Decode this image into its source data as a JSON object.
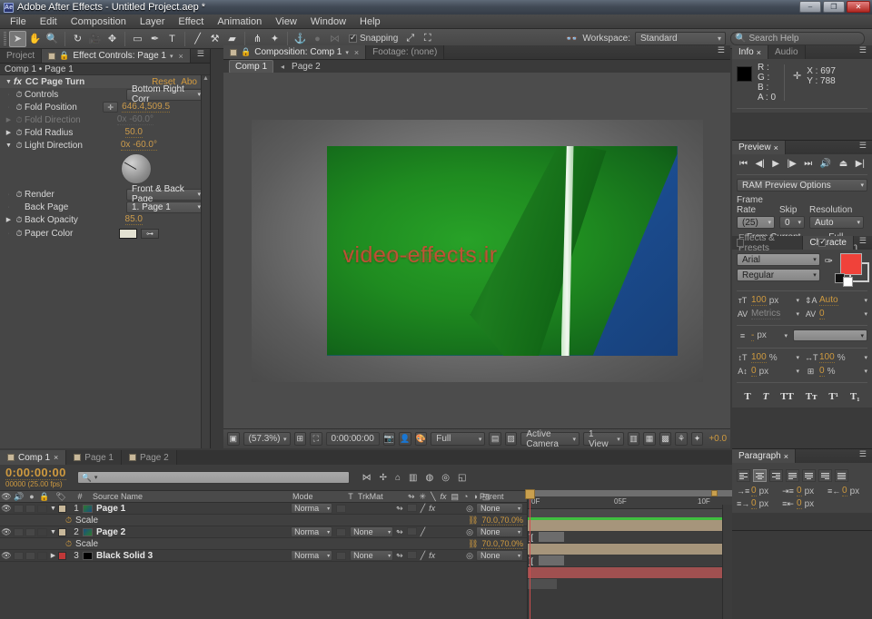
{
  "window": {
    "title": "Adobe After Effects - Untitled Project.aep *",
    "logo": "Ae",
    "minimize": "–",
    "maximize": "❐",
    "close": "✕"
  },
  "menu": [
    "File",
    "Edit",
    "Composition",
    "Layer",
    "Effect",
    "Animation",
    "View",
    "Window",
    "Help"
  ],
  "toolbar": {
    "tools": [
      {
        "name": "selection-tool",
        "glyph": "➤"
      },
      {
        "name": "hand-tool",
        "glyph": "✋"
      },
      {
        "name": "zoom-tool",
        "glyph": "🔍"
      },
      {
        "name": "rotation-tool",
        "glyph": "↻"
      },
      {
        "name": "camera-tool",
        "glyph": "🎥"
      },
      {
        "name": "pan-behind-tool",
        "glyph": "✥"
      },
      {
        "name": "rectangle-tool",
        "glyph": "▭"
      },
      {
        "name": "pen-tool",
        "glyph": "✒"
      },
      {
        "name": "text-tool",
        "glyph": "T"
      },
      {
        "name": "brush-tool",
        "glyph": "╱"
      },
      {
        "name": "clone-stamp-tool",
        "glyph": "⚒"
      },
      {
        "name": "eraser-tool",
        "glyph": "▰"
      },
      {
        "name": "roto-brush-tool",
        "glyph": "⋔"
      },
      {
        "name": "puppet-pin-tool",
        "glyph": "✦"
      }
    ],
    "anchor_icons": [
      "⚓",
      "●",
      "⋈"
    ],
    "snapping_label": "Snapping",
    "snapping_checked": true,
    "extra_icons": [
      "⤢",
      "⛶"
    ],
    "workspace_label": "Workspace:",
    "workspace_value": "Standard",
    "search_placeholder": "Search Help"
  },
  "effect_controls": {
    "project_tab": "Project",
    "tab_title": "Effect Controls: Page 1",
    "breadcrumb": "Comp 1 • Page 1",
    "effect_name": "CC Page Turn",
    "fx_label": "fx",
    "reset_label": "Reset",
    "about_label": "Abo",
    "properties": [
      {
        "name": "Controls",
        "value": "Bottom Right Corr",
        "type": "select"
      },
      {
        "name": "Fold Position",
        "value": "646.4,509.5",
        "type": "position"
      },
      {
        "name": "Fold Direction",
        "value": "0x -60.0°",
        "type": "angle",
        "disabled": true
      },
      {
        "name": "Fold Radius",
        "value": "50.0",
        "type": "number"
      },
      {
        "name": "Light Direction",
        "value": "0x -60.0°",
        "type": "angle-dial"
      },
      {
        "name": "Render",
        "value": "Front & Back Page",
        "type": "select"
      },
      {
        "name": "Back Page",
        "value": "1. Page 1",
        "type": "select"
      },
      {
        "name": "Back Opacity",
        "value": "85.0",
        "type": "number"
      },
      {
        "name": "Paper Color",
        "value": "",
        "type": "color",
        "color": "#e4e2d2"
      }
    ]
  },
  "composition": {
    "tab_title": "Composition: Comp 1",
    "footage_tab": "Footage: (none)",
    "breadcrumb_active": "Comp 1",
    "breadcrumb_next": "Page 2",
    "watermark_text": "video-effects.ir",
    "page_front_color": "#1f8b20",
    "page_back_color": "#1d539c",
    "watermark_color": "#e0453a",
    "bottom_bar": {
      "zoom": "(57.3%)",
      "time": "0:00:00:00",
      "resolution": "Full",
      "view_camera": "Active Camera",
      "view_count": "1 View",
      "exposure": "+0.0"
    }
  },
  "info_panel": {
    "tabs": [
      "Info",
      "Audio"
    ],
    "active_tab": "Info",
    "r_label": "R :",
    "g_label": "G :",
    "b_label": "B :",
    "a_label": "A : 0",
    "x_value": "X : 697",
    "y_value": "Y : 788"
  },
  "preview_panel": {
    "tab": "Preview",
    "transport": [
      "⏮",
      "◀|",
      "▶",
      "|▶",
      "⏭",
      "🔊",
      "⏏",
      "▶|"
    ],
    "ram_preview_options": "RAM Preview Options",
    "frame_rate_label": "Frame Rate",
    "frame_rate_value": "(25)",
    "skip_label": "Skip",
    "skip_value": "0",
    "resolution_label": "Resolution",
    "resolution_value": "Auto",
    "from_current_time_label": "From Current Time",
    "from_current_time_checked": false,
    "full_screen_label": "Full Screen",
    "full_screen_checked": true
  },
  "character_panel": {
    "tabs": [
      "Effects & Presets",
      "Characte"
    ],
    "active_tab": "Characte",
    "font_family": "Arial",
    "font_style": "Regular",
    "fill_color": "#f0423a",
    "font_size": "100",
    "font_size_unit": "px",
    "leading": "Auto",
    "kerning": "Metrics",
    "tracking": "0",
    "stroke_width": "-",
    "stroke_unit": "px",
    "vertical_scale": "100",
    "horizontal_scale": "100",
    "baseline_shift": "0",
    "baseline_unit": "px",
    "tsume": "0",
    "tsume_unit": "%",
    "percent": "%",
    "styles": [
      "T",
      "T",
      "TT",
      "Tᴛ",
      "T¹",
      "T₁"
    ]
  },
  "paragraph_panel": {
    "tab": "Paragraph",
    "align_buttons": [
      "left",
      "center",
      "right",
      "justify-last-left",
      "justify-last-center",
      "justify-last-right",
      "justify-all"
    ],
    "selected_align": 1,
    "indent_left": "0",
    "indent_right": "0",
    "indent_first": "0",
    "space_before": "0",
    "space_after": "0",
    "unit": "px"
  },
  "timeline": {
    "tabs": [
      {
        "label": "Comp 1",
        "active": true
      },
      {
        "label": "Page 1",
        "active": false
      },
      {
        "label": "Page 2",
        "active": false
      }
    ],
    "current_time": "0:00:00:00",
    "frame_info": "00000 (25.00 fps)",
    "search_placeholder": "",
    "columns": [
      "#",
      "Source Name",
      "Mode",
      "T",
      "TrkMat",
      "Parent"
    ],
    "ruler_labels": [
      {
        "label": "0F",
        "pos": 4
      },
      {
        "label": "05F",
        "pos": 48
      },
      {
        "label": "10F",
        "pos": 92
      }
    ],
    "layers": [
      {
        "index": "1",
        "name": "Page 1",
        "color": "#c8b89a",
        "mode": "Norma",
        "trkmat": "",
        "parent": "None",
        "bar_color": "#a6957b",
        "expanded": true,
        "has_fx": true,
        "property": {
          "name": "Scale",
          "value": "70.0,70.0%"
        }
      },
      {
        "index": "2",
        "name": "Page 2",
        "color": "#c8b89a",
        "mode": "Norma",
        "trkmat": "None",
        "parent": "None",
        "bar_color": "#a6957b",
        "expanded": true,
        "has_fx": false,
        "property": {
          "name": "Scale",
          "value": "70.0,70.0%"
        }
      },
      {
        "index": "3",
        "name": "Black Solid 3",
        "color": "#c03838",
        "mode": "Norma",
        "trkmat": "None",
        "parent": "None",
        "bar_color": "#a05050",
        "expanded": false,
        "has_fx": true,
        "property": null
      }
    ]
  }
}
